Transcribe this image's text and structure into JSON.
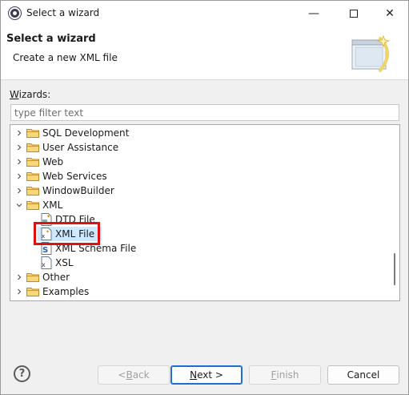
{
  "window": {
    "title": "Select a wizard",
    "minimize_glyph": "—",
    "close_glyph": "✕"
  },
  "banner": {
    "title": "Select a wizard",
    "subtitle": "Create a new XML file"
  },
  "wizards": {
    "label_mnemonic": "W",
    "label_rest": "izards:",
    "filter_placeholder": "type filter text",
    "filter_value": ""
  },
  "tree": {
    "items": [
      {
        "label": "SQL Development",
        "type": "folder",
        "expanded": false,
        "level": 0
      },
      {
        "label": "User Assistance",
        "type": "folder",
        "expanded": false,
        "level": 0
      },
      {
        "label": "Web",
        "type": "folder",
        "expanded": false,
        "level": 0
      },
      {
        "label": "Web Services",
        "type": "folder",
        "expanded": false,
        "level": 0
      },
      {
        "label": "WindowBuilder",
        "type": "folder",
        "expanded": false,
        "level": 0
      },
      {
        "label": "XML",
        "type": "folder",
        "expanded": true,
        "level": 0
      },
      {
        "label": "DTD File",
        "type": "file",
        "icon": "dtd-file-icon",
        "level": 1
      },
      {
        "label": "XML File",
        "type": "file",
        "icon": "xml-file-icon",
        "level": 1,
        "selected": true
      },
      {
        "label": "XML Schema File",
        "type": "file",
        "icon": "xml-schema-file-icon",
        "level": 1
      },
      {
        "label": "XSL",
        "type": "file",
        "icon": "xsl-file-icon",
        "level": 1
      },
      {
        "label": "Other",
        "type": "folder",
        "expanded": false,
        "level": 0
      },
      {
        "label": "Examples",
        "type": "folder",
        "expanded": false,
        "level": 0
      }
    ]
  },
  "buttons": {
    "help_glyph": "?",
    "back_prefix": "< ",
    "back_mnemonic": "B",
    "back_rest": "ack",
    "next_mnemonic": "N",
    "next_rest": "ext >",
    "finish_mnemonic": "F",
    "finish_rest": "inish",
    "cancel": "Cancel"
  },
  "colors": {
    "selection": "#cde8ff",
    "highlight": "#e01010",
    "folder": "#e8b84a",
    "primary_border": "#1c6fd1"
  }
}
